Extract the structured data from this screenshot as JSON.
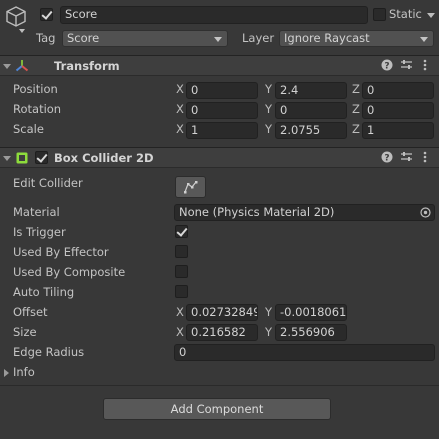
{
  "header": {
    "active": true,
    "name": "Score",
    "static_label": "Static",
    "tag_label": "Tag",
    "tag_value": "Score",
    "layer_label": "Layer",
    "layer_value": "Ignore Raycast"
  },
  "transform": {
    "title": "Transform",
    "rows": [
      {
        "label": "Position",
        "x": "0",
        "y": "2.4",
        "z": "0"
      },
      {
        "label": "Rotation",
        "x": "0",
        "y": "0",
        "z": "0"
      },
      {
        "label": "Scale",
        "x": "1",
        "y": "2.0755",
        "z": "1"
      }
    ],
    "axis": {
      "x": "X",
      "y": "Y",
      "z": "Z"
    }
  },
  "box_collider": {
    "enabled": true,
    "title": "Box Collider 2D",
    "edit_collider_label": "Edit Collider",
    "material_label": "Material",
    "material_value": "None (Physics Material 2D)",
    "is_trigger_label": "Is Trigger",
    "is_trigger": true,
    "used_by_effector_label": "Used By Effector",
    "used_by_effector": false,
    "used_by_composite_label": "Used By Composite",
    "used_by_composite": false,
    "auto_tiling_label": "Auto Tiling",
    "auto_tiling": false,
    "offset_label": "Offset",
    "offset_x": "0.02732849",
    "offset_y": "-0.0018061",
    "size_label": "Size",
    "size_x": "0.216582",
    "size_y": "2.556906",
    "edge_radius_label": "Edge Radius",
    "edge_radius": "0",
    "info_label": "Info"
  },
  "add_component_label": "Add Component",
  "colors": {
    "background": "#383838",
    "field": "#2a2a2a",
    "header": "#3e3e3e",
    "collider_icon": "#8ddc3c"
  },
  "icons": [
    "cube-icon",
    "help-icon",
    "preset-icon",
    "more-icon",
    "transform-icon",
    "collider-icon",
    "edit-collider-icon",
    "object-picker-icon"
  ]
}
